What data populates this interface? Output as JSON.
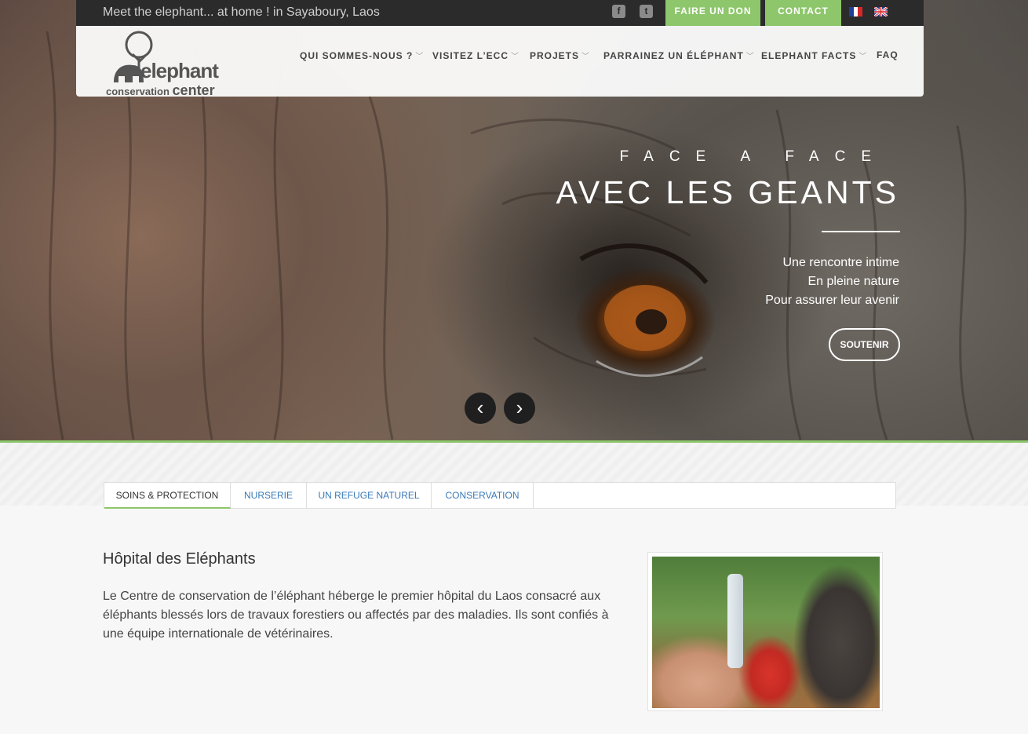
{
  "topbar": {
    "tagline": "Meet the elephant... at home ! in Sayaboury, Laos",
    "donate_label": "FAIRE UN DON",
    "contact_label": "CONTACT",
    "social": [
      "facebook-icon",
      "twitter-icon"
    ],
    "languages": [
      "flag-fr-icon",
      "flag-uk-icon"
    ]
  },
  "logo": {
    "line1": "elephant",
    "line2a": "conservation",
    "line2b": "center"
  },
  "nav": {
    "items": [
      {
        "label": "QUI SOMMES-NOUS ?",
        "dropdown": true
      },
      {
        "label": "VISITEZ L’ECC",
        "dropdown": true
      },
      {
        "label": "PROJETS",
        "dropdown": true
      },
      {
        "label": "PARRAINEZ UN ÉLÉPHANT",
        "dropdown": true
      },
      {
        "label": "ELEPHANT FACTS",
        "dropdown": true
      },
      {
        "label": "FAQ",
        "dropdown": false
      }
    ]
  },
  "hero": {
    "subtitle": "FACE A FACE",
    "title": "AVEC LES GEANTS",
    "lines": [
      "Une rencontre intime",
      "En pleine nature",
      "Pour assurer leur avenir"
    ],
    "cta_label": "SOUTENIR",
    "prev_icon": "‹",
    "next_icon": "›"
  },
  "tabs": [
    {
      "label": "SOINS & PROTECTION",
      "active": true
    },
    {
      "label": "NURSERIE",
      "active": false
    },
    {
      "label": "UN REFUGE NATUREL",
      "active": false
    },
    {
      "label": "CONSERVATION",
      "active": false
    }
  ],
  "section": {
    "title": "Hôpital des Eléphants",
    "text": "Le Centre de conservation de l’éléphant héberge le premier hôpital du Laos consacré aux éléphants blessés lors de travaux forestiers ou affectés par des maladies. Ils sont confiés à une équipe internationale de vétérinaires."
  },
  "colors": {
    "accent_green": "#8dc66b",
    "topbar": "#2b2b2b",
    "link_blue": "#3a7ab8"
  }
}
